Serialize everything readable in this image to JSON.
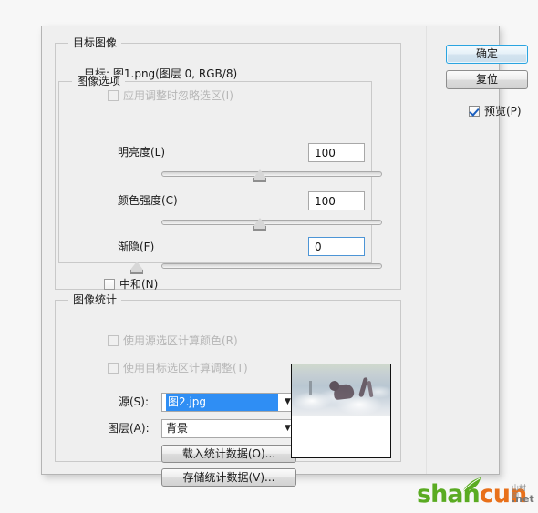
{
  "dialog": {
    "target_group": {
      "legend": "目标图像",
      "target_label": "目标:",
      "target_value": "图1.png(图层 0, RGB/8)",
      "ignore_selection_checkbox": {
        "label": "应用调整时忽略选区(I)",
        "mnemonic": "I",
        "checked": false,
        "enabled": false
      }
    },
    "image_options_group": {
      "legend": "图像选项",
      "luminance": {
        "label": "明亮度(L)",
        "mnemonic": "L",
        "value": "100",
        "slider_percent": 42
      },
      "color_intensity": {
        "label": "颜色强度(C)",
        "mnemonic": "C",
        "value": "100",
        "slider_percent": 42
      },
      "fade": {
        "label": "渐隐(F)",
        "mnemonic": "F",
        "value": "0",
        "slider_percent": 0,
        "focused": true
      },
      "neutralize_checkbox": {
        "label": "中和(N)",
        "mnemonic": "N",
        "checked": false,
        "enabled": true
      }
    },
    "image_statistics_group": {
      "legend": "图像统计",
      "use_source_selection_checkbox": {
        "label": "使用源选区计算颜色(R)",
        "mnemonic": "R",
        "checked": false,
        "enabled": false
      },
      "use_target_selection_checkbox": {
        "label": "使用目标选区计算调整(T)",
        "mnemonic": "T",
        "checked": false,
        "enabled": false
      },
      "source": {
        "label": "源(S):",
        "mnemonic": "S",
        "value": "图2.jpg",
        "selected": true
      },
      "layer": {
        "label": "图层(A):",
        "mnemonic": "A",
        "value": "背景",
        "selected": false
      },
      "load_statistics_button": "载入统计数据(O)...",
      "save_statistics_button": "存储统计数据(V)..."
    },
    "buttons": {
      "ok": "确定",
      "reset": "复位",
      "preview_checkbox": {
        "label": "预览(P)",
        "mnemonic": "P",
        "checked": true,
        "enabled": true
      }
    },
    "colors": {
      "dialog_bg": "#efefef",
      "selection_blue": "#2f8ef4",
      "focus_blue": "#4d95d6",
      "default_button_border": "#2aa4e0",
      "disabled_text": "#b6b6b6"
    }
  },
  "watermark": {
    "part1": "shan",
    "part2": "cun",
    "cn": "山村网",
    "tld": ".net"
  }
}
